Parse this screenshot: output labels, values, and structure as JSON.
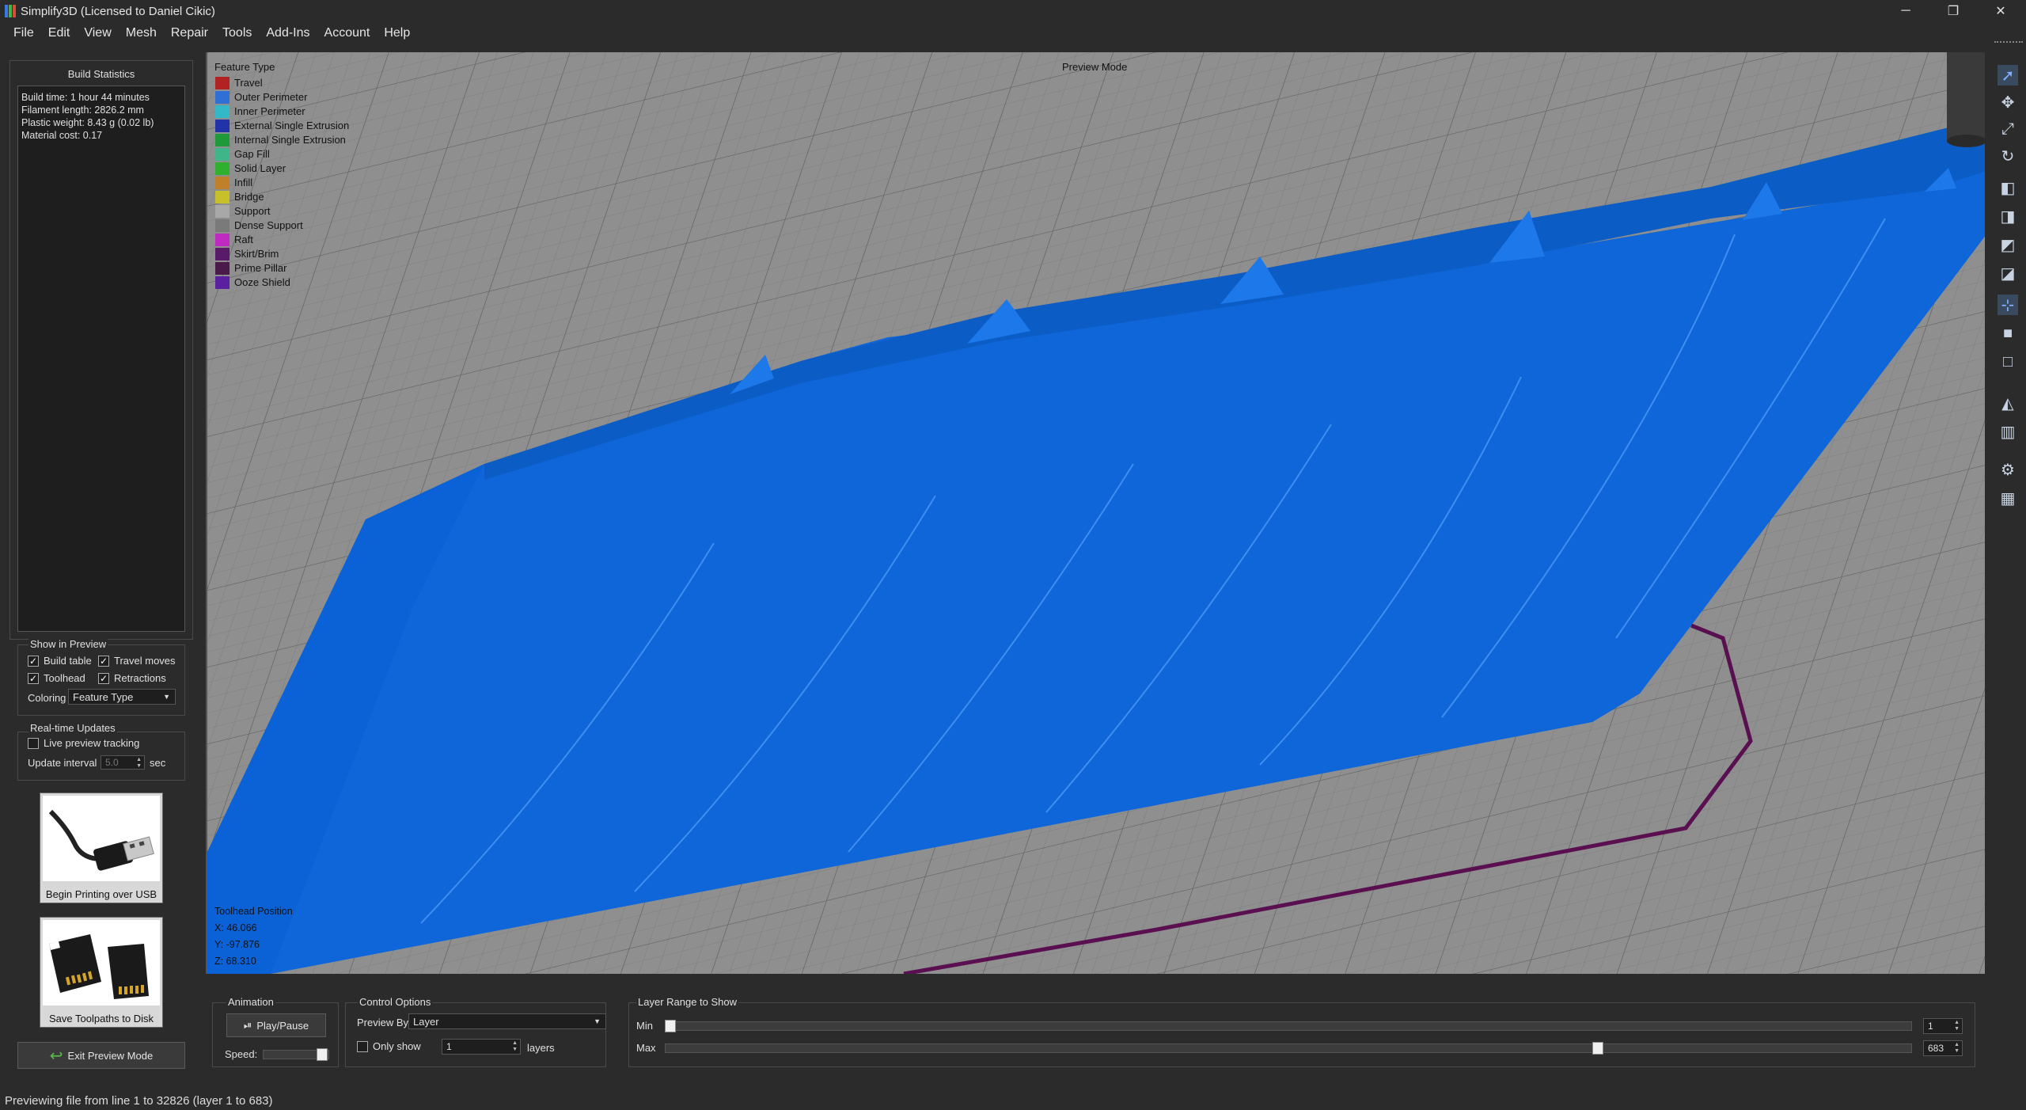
{
  "window": {
    "title": "Simplify3D (Licensed to Daniel Cikic)",
    "minimize_glyph": "─",
    "restore_glyph": "❐",
    "close_glyph": "✕"
  },
  "menu": [
    "File",
    "Edit",
    "View",
    "Mesh",
    "Repair",
    "Tools",
    "Add-Ins",
    "Account",
    "Help"
  ],
  "left_panel": {
    "build_statistics_title": "Build Statistics",
    "stats": [
      "Build time: 1 hour 44 minutes",
      "Filament length: 2826.2 mm",
      "Plastic weight: 8.43 g (0.02 lb)",
      "Material cost: 0.17"
    ],
    "show_in_preview": {
      "title": "Show in Preview",
      "build_table": "Build table",
      "travel_moves": "Travel moves",
      "toolhead": "Toolhead",
      "retractions": "Retractions",
      "coloring_label": "Coloring",
      "coloring_value": "Feature Type"
    },
    "realtime": {
      "title": "Real-time Updates",
      "live_tracking": "Live preview tracking",
      "interval_label": "Update interval",
      "interval_value": "5.0",
      "interval_unit": "sec"
    },
    "usb_label": "Begin Printing over USB",
    "sd_label": "Save Toolpaths to Disk",
    "exit_label": "Exit Preview Mode"
  },
  "viewport": {
    "legend_title": "Feature Type",
    "legend": [
      {
        "label": "Travel",
        "color": "#b22222"
      },
      {
        "label": "Outer Perimeter",
        "color": "#2f6fd6"
      },
      {
        "label": "Inner Perimeter",
        "color": "#33b8c8"
      },
      {
        "label": "External Single Extrusion",
        "color": "#2233aa"
      },
      {
        "label": "Internal Single Extrusion",
        "color": "#1f9a3a"
      },
      {
        "label": "Gap Fill",
        "color": "#3fb58a"
      },
      {
        "label": "Solid Layer",
        "color": "#2fb02f"
      },
      {
        "label": "Infill",
        "color": "#c0802a"
      },
      {
        "label": "Bridge",
        "color": "#c8c02a"
      },
      {
        "label": "Support",
        "color": "#a8a8a8"
      },
      {
        "label": "Dense Support",
        "color": "#7a7a7a"
      },
      {
        "label": "Raft",
        "color": "#c02ac0"
      },
      {
        "label": "Skirt/Brim",
        "color": "#5a1a6a"
      },
      {
        "label": "Prime Pillar",
        "color": "#4a1a4a"
      },
      {
        "label": "Ooze Shield",
        "color": "#5a20a0"
      }
    ],
    "preview_mode": "Preview Mode",
    "toolhead_title": "Toolhead Position",
    "toolhead_x": "X: 46.066",
    "toolhead_y": "Y: -97.876",
    "toolhead_z": "Z: 68.310"
  },
  "right_toolbar": [
    "select-icon",
    "move-icon",
    "scale-icon",
    "rotate-icon",
    "view-top-icon",
    "view-front-icon",
    "view-side-icon",
    "view-iso-icon",
    "axes-icon",
    "solid-view-icon",
    "wireframe-icon",
    "cross-section-icon",
    "material-icon",
    "settings-icon",
    "bed-icon"
  ],
  "bottom_panel": {
    "animation_title": "Animation",
    "play_label": "Play/Pause",
    "speed_label": "Speed:",
    "control_title": "Control Options",
    "preview_by_label": "Preview By",
    "preview_by_value": "Layer",
    "only_show_label": "Only show",
    "only_show_value": "1",
    "layers_label": "layers",
    "layer_range_title": "Layer Range to Show",
    "min_label": "Min",
    "max_label": "Max",
    "min_value": "1",
    "max_value": "683",
    "total_layers": 683,
    "min_layer": 1,
    "max_layer": 683,
    "max_slider_fraction": 0.75
  },
  "status": "Previewing file from line 1 to 32826 (layer 1 to 683)"
}
